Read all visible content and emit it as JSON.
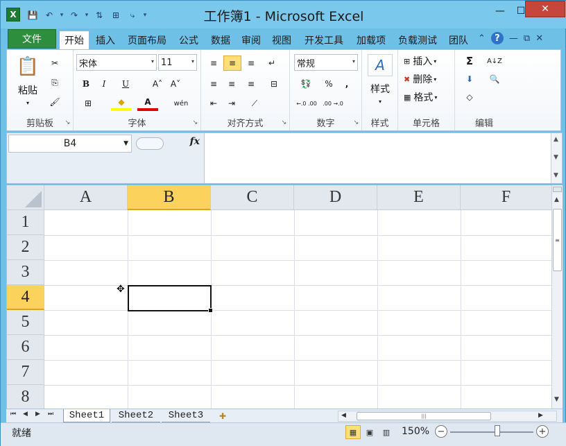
{
  "window": {
    "title": "工作簿1 - Microsoft Excel",
    "app_icon": "X",
    "controls": {
      "minimize": "—",
      "maximize": "☐",
      "close": "✕"
    }
  },
  "quick_access": {
    "save": "💾",
    "undo": "↶",
    "redo": "↷",
    "sort": "⇅",
    "filter": "⊞",
    "more": "▾"
  },
  "ribbon_tabs": {
    "file": "文件",
    "items": [
      "开始",
      "插入",
      "页面布局",
      "公式",
      "数据",
      "审阅",
      "视图",
      "开发工具",
      "加载项",
      "负载测试",
      "团队"
    ],
    "active_index": 0
  },
  "ribbon": {
    "clipboard": {
      "label": "剪贴板",
      "paste": "粘贴",
      "cut": "✂",
      "copy": "⎘",
      "format_painter": "🖌"
    },
    "font": {
      "label": "字体",
      "name": "宋体",
      "size": "11",
      "bold": "B",
      "italic": "I",
      "underline": "U",
      "grow": "A˄",
      "shrink": "A˅",
      "border": "⊞",
      "fill": "◆",
      "color": "A",
      "phonetic": "wén"
    },
    "alignment": {
      "label": "对齐方式",
      "top": "≡",
      "middle": "≡",
      "bottom": "≡",
      "wrap": "↵",
      "left": "≡",
      "center": "≡",
      "right": "≡",
      "merge": "⊟",
      "indent_dec": "⇤",
      "indent_inc": "⇥",
      "orientation": "⟋"
    },
    "number": {
      "label": "数字",
      "format": "常规",
      "currency": "💱",
      "percent": "%",
      "comma": ",",
      "inc_decimal": "←.0 .00",
      "dec_decimal": ".00 →.0"
    },
    "styles": {
      "label": "样式",
      "button": "样式"
    },
    "cells": {
      "label": "单元格",
      "insert": "插入",
      "delete": "删除",
      "format": "格式"
    },
    "editing": {
      "label": "编辑",
      "sum": "Σ",
      "sort": "A↓Z",
      "fill": "⬇",
      "find": "🔍",
      "clear": "◇"
    }
  },
  "formula_bar": {
    "name_box": "B4",
    "fx": "fx",
    "formula": ""
  },
  "grid": {
    "columns": [
      "A",
      "B",
      "C",
      "D",
      "E",
      "F"
    ],
    "rows": [
      "1",
      "2",
      "3",
      "4",
      "5",
      "6",
      "7",
      "8"
    ],
    "selected_column": "B",
    "selected_row": "4"
  },
  "sheet_tabs": {
    "tabs": [
      "Sheet1",
      "Sheet2",
      "Sheet3"
    ],
    "active_index": 0
  },
  "status_bar": {
    "status": "就绪",
    "zoom": "150%",
    "zoom_level": 150
  }
}
